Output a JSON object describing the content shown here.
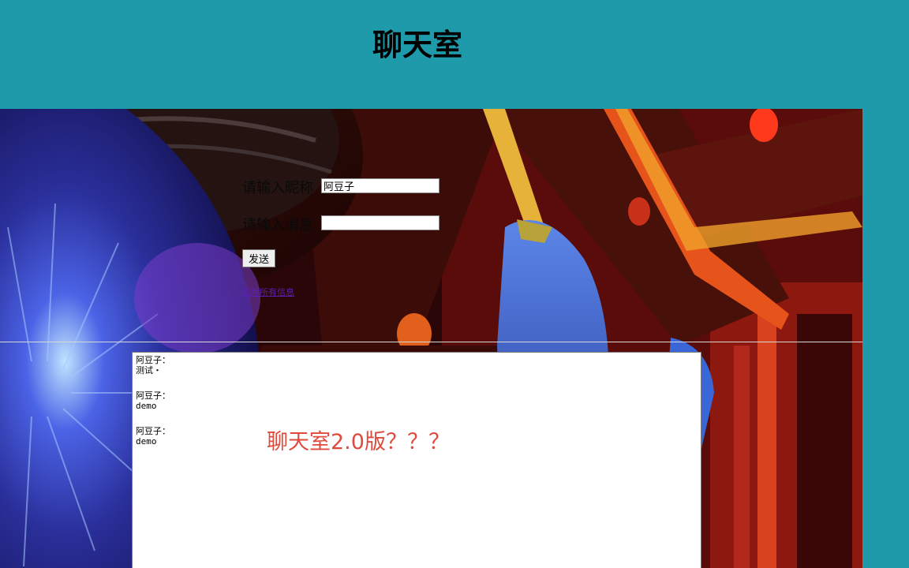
{
  "header": {
    "title": "聊天室"
  },
  "form": {
    "nickname_label": "请输入昵称",
    "nickname_value": "阿豆子",
    "message_label": "请输入消息",
    "message_value": "",
    "send_label": "发送",
    "clear_link": "清除所有信息"
  },
  "messages": [
    {
      "author": "阿豆子：",
      "text": "测试・"
    },
    {
      "author": "阿豆子：",
      "text": "demo"
    },
    {
      "author": "阿豆子：",
      "text": "demo"
    }
  ],
  "overlay": {
    "version_note": "聊天室2.0版？？？"
  },
  "colors": {
    "header_bg": "#1e9aaa",
    "overlay_text": "#e04a3c"
  }
}
